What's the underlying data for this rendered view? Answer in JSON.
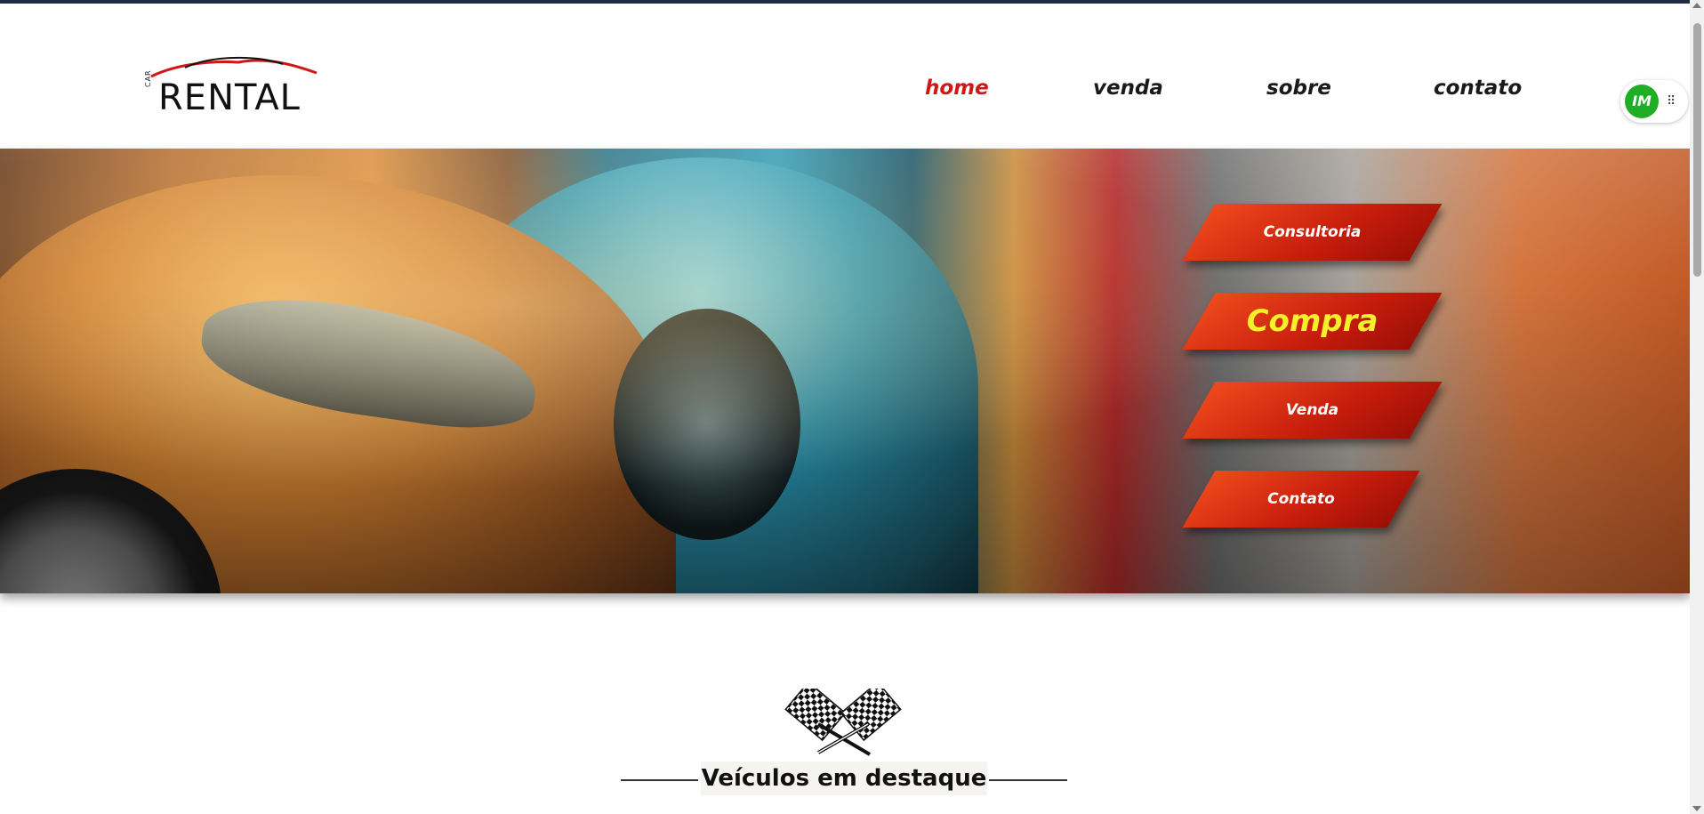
{
  "logo": {
    "vertical_text": "CAR",
    "wordmark": "RENTAL",
    "accent": "#d01818"
  },
  "nav": {
    "items": [
      {
        "label": "home",
        "active": true
      },
      {
        "label": "venda",
        "active": false
      },
      {
        "label": "sobre",
        "active": false
      },
      {
        "label": "contato",
        "active": false
      }
    ],
    "active_color": "#d01818"
  },
  "badge": {
    "initials": "IM",
    "color": "#1fae26",
    "icon": "drag-grip-icon"
  },
  "hero": {
    "menu": [
      {
        "label": "Consultoria"
      },
      {
        "label": "Compra",
        "highlight": true
      },
      {
        "label": "Venda"
      },
      {
        "label": "Contato"
      }
    ],
    "button_color": "#d3260f",
    "highlight_text_color": "#f4f02a"
  },
  "featured": {
    "icon": "checkered-flags-icon",
    "title": "Veículos em destaque"
  }
}
